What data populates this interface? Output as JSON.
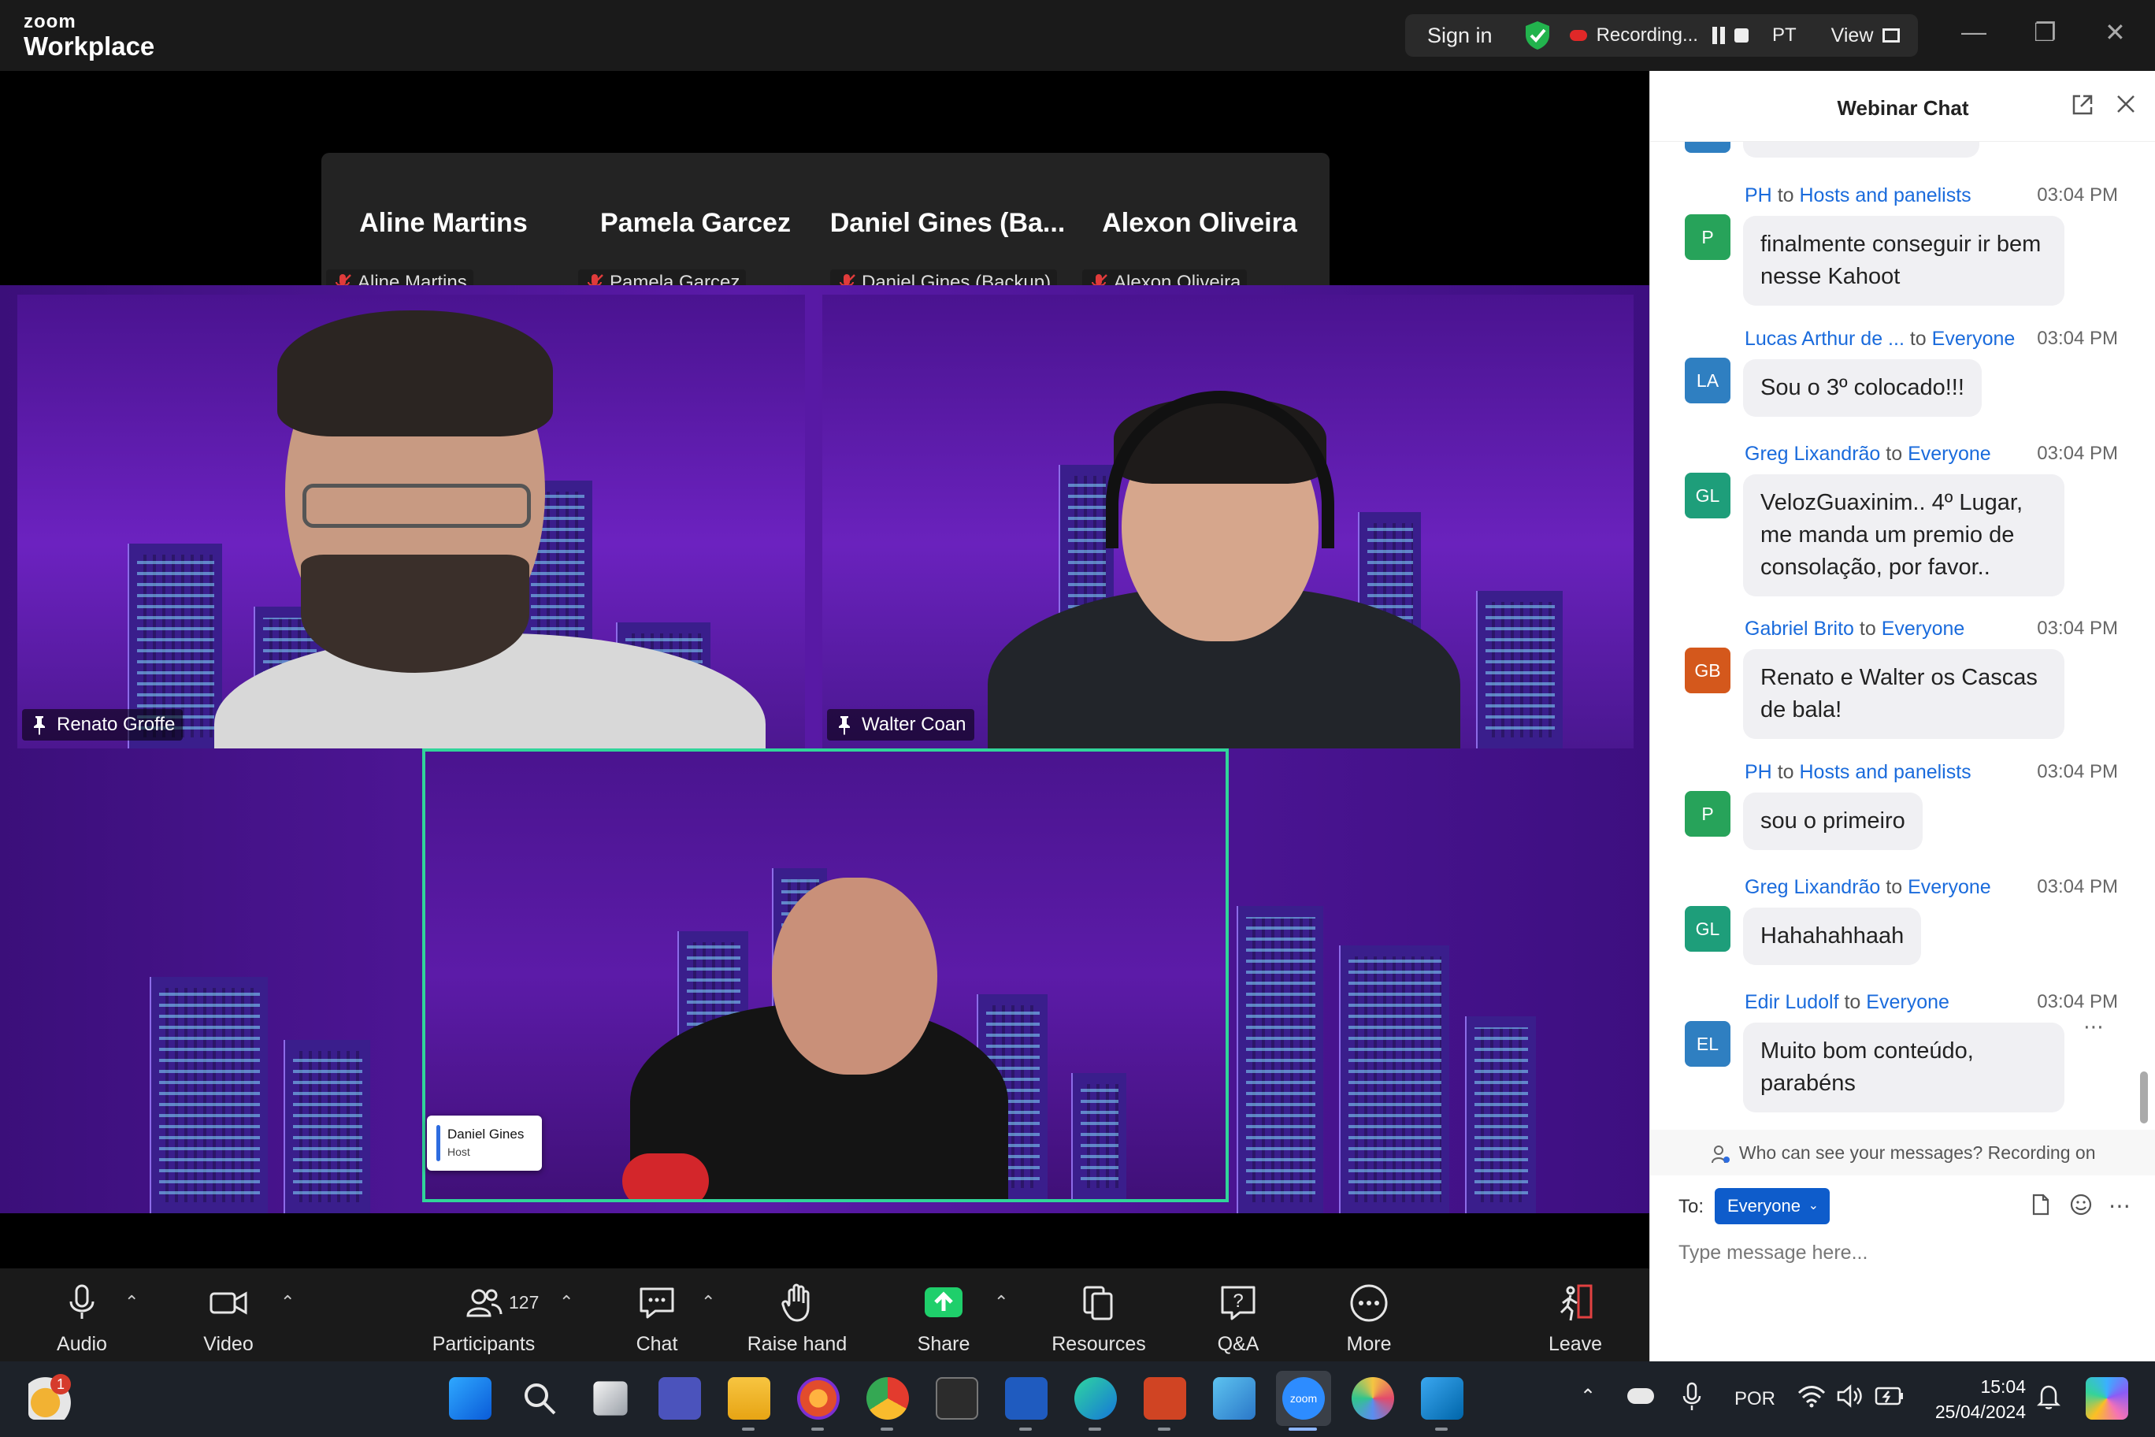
{
  "window": {
    "logo_small": "zoom",
    "logo_main": "Workplace",
    "signin": "Sign in",
    "recording": "Recording...",
    "language": "PT",
    "view": "View"
  },
  "strip": [
    {
      "name": "Aline Martins",
      "tag": "Aline Martins"
    },
    {
      "name": "Pamela Garcez",
      "tag": "Pamela Garcez"
    },
    {
      "name": "Daniel  Gines  (Ba...",
      "tag": "Daniel Gines (Backup)"
    },
    {
      "name": "Alexon Oliveira",
      "tag": "Alexon Oliveira"
    }
  ],
  "videos": {
    "tile1": "Renato Groffe",
    "tile2": "Walter Coan",
    "tile3_name": "Daniel Gines",
    "tile3_role": "Host"
  },
  "toolbar": {
    "audio": "Audio",
    "video": "Video",
    "participants": "Participants",
    "participants_count": "127",
    "chat": "Chat",
    "raise_hand": "Raise hand",
    "share": "Share",
    "resources": "Resources",
    "qa": "Q&A",
    "more": "More",
    "leave": "Leave"
  },
  "chat": {
    "title": "Webinar Chat",
    "messages": [
      {
        "name": "PH",
        "to_word": "to",
        "recipient": "Hosts and panelists",
        "time": "03:04 PM",
        "initials": "P",
        "color": "#27a35a",
        "text": "finalmente conseguir ir bem nesse Kahoot"
      },
      {
        "name": "Lucas Arthur de ...",
        "to_word": "to",
        "recipient": "Everyone",
        "time": "03:04 PM",
        "initials": "LA",
        "color": "#2f7fc1",
        "text": "Sou o 3º colocado!!!"
      },
      {
        "name": "Greg Lixandrão",
        "to_word": "to",
        "recipient": "Everyone",
        "time": "03:04 PM",
        "initials": "GL",
        "color": "#1e9e7a",
        "text": "VelozGuaxinim.. 4º Lugar, me manda um premio de consolação, por favor.."
      },
      {
        "name": "Gabriel Brito",
        "to_word": "to",
        "recipient": "Everyone",
        "time": "03:04 PM",
        "initials": "GB",
        "color": "#d4581c",
        "text": "Renato e Walter os Cascas de bala!"
      },
      {
        "name": "PH",
        "to_word": "to",
        "recipient": "Hosts and panelists",
        "time": "03:04 PM",
        "initials": "P",
        "color": "#27a35a",
        "text": "sou o primeiro"
      },
      {
        "name": "Greg Lixandrão",
        "to_word": "to",
        "recipient": "Everyone",
        "time": "03:04 PM",
        "initials": "GL",
        "color": "#1e9e7a",
        "text": "Hahahahhaah"
      },
      {
        "name": "Edir Ludolf",
        "to_word": "to",
        "recipient": "Everyone",
        "time": "03:04 PM",
        "initials": "EL",
        "color": "#2f7fc1",
        "text": "Muito bom conteúdo, parabéns"
      }
    ],
    "notice": "Who can see your messages? Recording on",
    "to_label": "To:",
    "to_value": "Everyone",
    "input_placeholder": "Type message here..."
  },
  "taskbar": {
    "weather_badge": "1",
    "language": "POR",
    "time": "15:04",
    "date": "25/04/2024",
    "zoom_label": "zoom"
  }
}
